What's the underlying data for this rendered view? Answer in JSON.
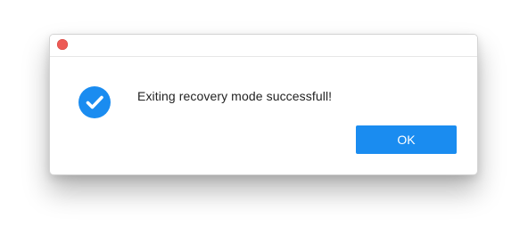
{
  "dialog": {
    "message": "Exiting recovery mode successfull!",
    "ok_label": "OK",
    "icon": "check-circle-icon",
    "close_icon": "close-dot-icon"
  },
  "colors": {
    "accent": "#1a8cf0",
    "close": "#ed5a55",
    "check_circle": "#1a8cf0"
  }
}
